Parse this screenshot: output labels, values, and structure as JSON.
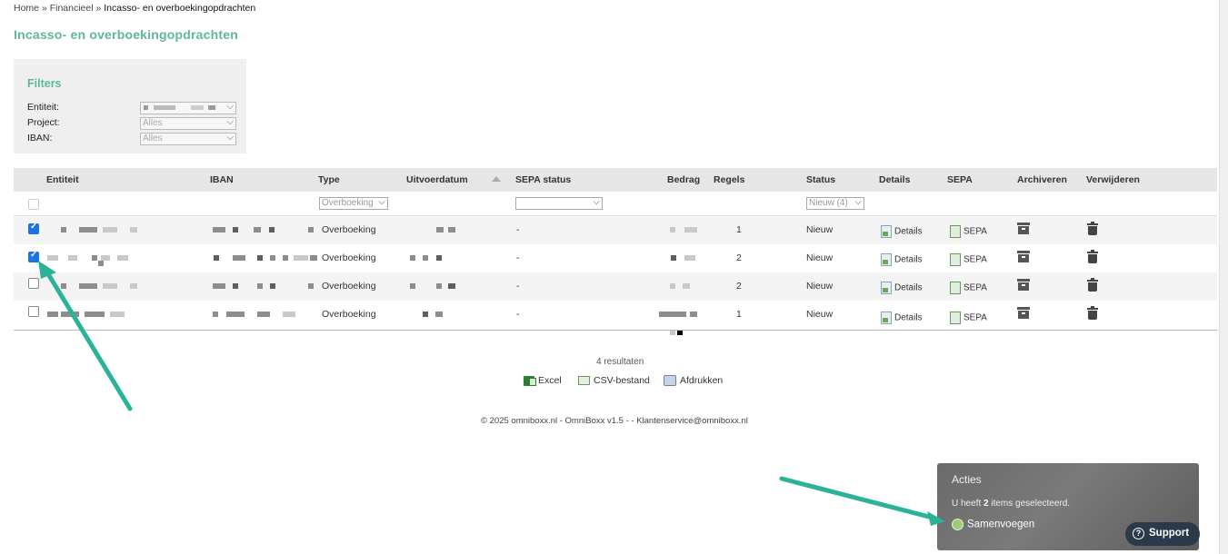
{
  "breadcrumb": [
    "Home",
    "»",
    "Financieel",
    "»",
    "Incasso- en overboekingopdrachten"
  ],
  "page_title": "Incasso- en overboekingopdrachten",
  "filters": {
    "title": "Filters",
    "rows": [
      {
        "label": "Entiteit:",
        "value": ""
      },
      {
        "label": "Project:",
        "value": "Alles"
      },
      {
        "label": "IBAN:",
        "value": "Alles"
      }
    ]
  },
  "table": {
    "headers": [
      "Entiteit",
      "IBAN",
      "Type",
      "Uitvoerdatum",
      "SEPA status",
      "Bedrag",
      "Regels",
      "Status",
      "Details",
      "SEPA",
      "Archiveren",
      "Verwijderen"
    ],
    "filter_type": "Overboeking",
    "filter_sepa": "",
    "filter_status": "Nieuw (4)",
    "rows": [
      {
        "checked": true,
        "type": "Overboeking",
        "sepa_status": "-",
        "regels": "1",
        "status": "Nieuw",
        "details": "Details",
        "sepa": "SEPA"
      },
      {
        "checked": true,
        "type": "Overboeking",
        "sepa_status": "-",
        "regels": "2",
        "status": "Nieuw",
        "details": "Details",
        "sepa": "SEPA"
      },
      {
        "checked": false,
        "type": "Overboeking",
        "sepa_status": "-",
        "regels": "2",
        "status": "Nieuw",
        "details": "Details",
        "sepa": "SEPA"
      },
      {
        "checked": false,
        "type": "Overboeking",
        "sepa_status": "-",
        "regels": "1",
        "status": "Nieuw",
        "details": "Details",
        "sepa": "SEPA"
      }
    ]
  },
  "results": "4 resultaten",
  "exports": {
    "excel": "Excel",
    "csv": "CSV-bestand",
    "print": "Afdrukken"
  },
  "footer": "© 2025 omniboxx.nl - OmniBoxx v1.5 - - Klantenservice@omniboxx.nl",
  "actions": {
    "title": "Acties",
    "selected_prefix": "U heeft",
    "selected_count": "2",
    "selected_suffix": "items geselecteerd.",
    "merge": "Samenvoegen"
  },
  "support": "Support",
  "colors": {
    "accent": "#5fb89a",
    "arrow": "#2bb39a",
    "checkbox": "#1a73e8"
  }
}
